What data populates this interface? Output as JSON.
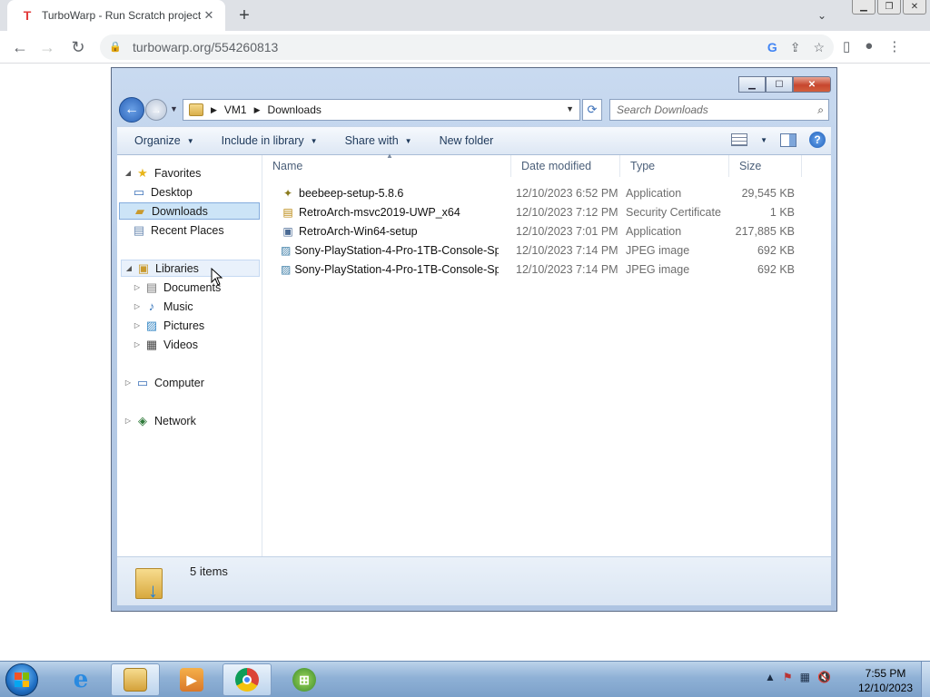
{
  "browser": {
    "tab_title": "TurboWarp - Run Scratch project",
    "tab_favicon": "turbowarp-logo-icon",
    "tab_close": "✕",
    "new_tab": "+",
    "url": "turbowarp.org/554260813"
  },
  "explorer": {
    "breadcrumbs": [
      "VM1",
      "Downloads"
    ],
    "search_placeholder": "Search Downloads",
    "commands": {
      "organize": "Organize",
      "include_in_library": "Include in library",
      "share_with": "Share with",
      "new_folder": "New folder"
    },
    "nav": {
      "favorites": "Favorites",
      "desktop": "Desktop",
      "downloads": "Downloads",
      "recent_places": "Recent Places",
      "libraries": "Libraries",
      "documents": "Documents",
      "music": "Music",
      "pictures": "Pictures",
      "videos": "Videos",
      "computer": "Computer",
      "network": "Network"
    },
    "columns": {
      "name": "Name",
      "date_modified": "Date modified",
      "type": "Type",
      "size": "Size"
    },
    "files": [
      {
        "name": "beebeep-setup-5.8.6",
        "date": "12/10/2023 6:52 PM",
        "type": "Application",
        "size": "29,545 KB",
        "icon": "installer-icon"
      },
      {
        "name": "RetroArch-msvc2019-UWP_x64",
        "date": "12/10/2023 7:12 PM",
        "type": "Security Certificate",
        "size": "1 KB",
        "icon": "certificate-icon"
      },
      {
        "name": "RetroArch-Win64-setup",
        "date": "12/10/2023 7:01 PM",
        "type": "Application",
        "size": "217,885 KB",
        "icon": "application-icon"
      },
      {
        "name": "Sony-PlayStation-4-Pro-1TB-Console-Sp...",
        "date": "12/10/2023 7:14 PM",
        "type": "JPEG image",
        "size": "692 KB",
        "icon": "image-icon"
      },
      {
        "name": "Sony-PlayStation-4-Pro-1TB-Console-Sp...",
        "date": "12/10/2023 7:14 PM",
        "type": "JPEG image",
        "size": "692 KB",
        "icon": "image-icon"
      }
    ],
    "item_count": "5 items"
  },
  "taskbar": {
    "clock_time": "7:55 PM",
    "clock_date": "12/10/2023"
  }
}
